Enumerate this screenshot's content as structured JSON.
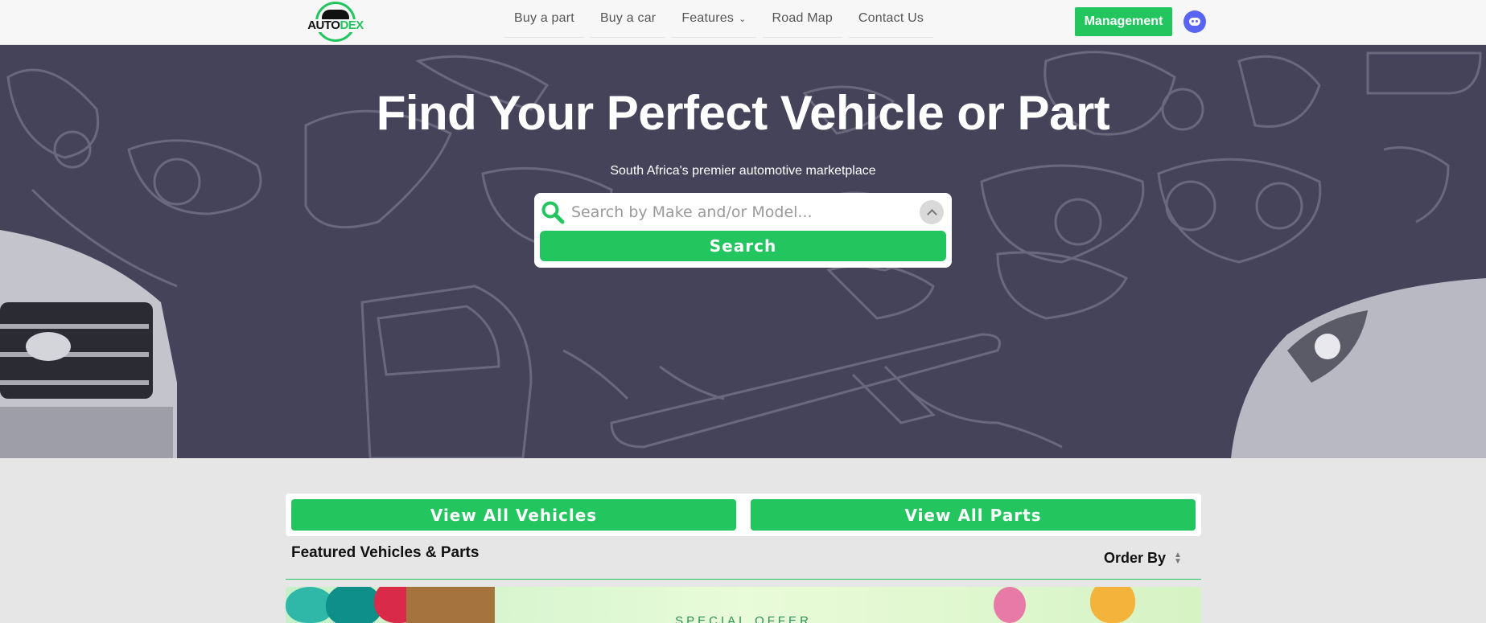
{
  "nav": {
    "logo": {
      "word_dark": "AUTO",
      "word_accent": "DEX"
    },
    "links": [
      {
        "label": "Buy a part",
        "has_dropdown": false
      },
      {
        "label": "Buy a car",
        "has_dropdown": false
      },
      {
        "label": "Features",
        "has_dropdown": true
      },
      {
        "label": "Road Map",
        "has_dropdown": false
      },
      {
        "label": "Contact Us",
        "has_dropdown": false
      }
    ],
    "management_label": "Management",
    "discord_icon": "discord-icon"
  },
  "hero": {
    "title": "Find Your Perfect Vehicle or Part",
    "subtitle": "South Africa's premier automotive marketplace",
    "search": {
      "placeholder": "Search by Make and/or Model...",
      "value": "",
      "button_label": "Search"
    }
  },
  "content": {
    "view_vehicles_label": "View All Vehicles",
    "view_parts_label": "View All Parts",
    "featured_title": "Featured Vehicles & Parts",
    "order_by_label": "Order By",
    "banner_text": "SPECIAL OFFER"
  },
  "colors": {
    "accent": "#22c55e",
    "hero_bg": "#44435a",
    "discord": "#5865f2"
  }
}
